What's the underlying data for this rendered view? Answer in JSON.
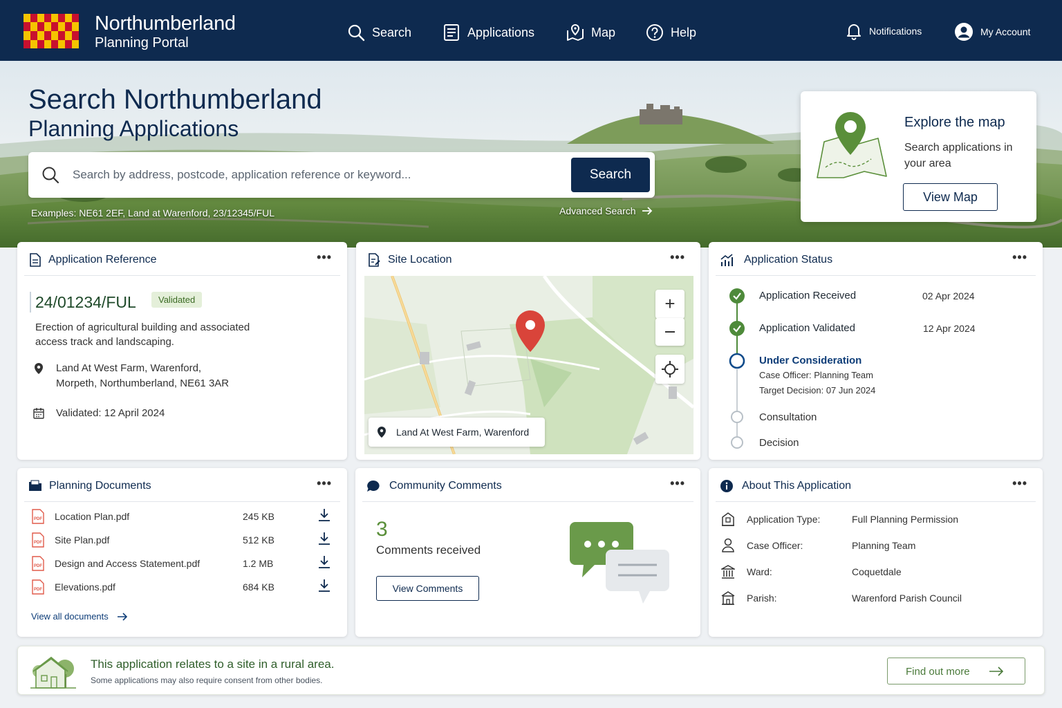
{
  "header": {
    "brand_title": "Northumberland",
    "brand_sub": "Planning Portal",
    "nav": [
      {
        "label": "Search",
        "icon": "search-icon"
      },
      {
        "label": "Applications",
        "icon": "document-icon"
      },
      {
        "label": "Map",
        "icon": "map-icon"
      },
      {
        "label": "Help",
        "icon": "help-icon"
      }
    ],
    "notifications_label": "Notifications",
    "account_label": "My Account"
  },
  "hero": {
    "title_line1": "Search Northumberland",
    "title_line2": "Planning Applications",
    "search_placeholder": "Search by address, postcode, application reference or keyword...",
    "search_button": "Search",
    "examples": "Examples:  NE61 2EF, Land at Warenford, 23/12345/FUL",
    "advanced_search": "Advanced Search"
  },
  "map_card": {
    "title": "Explore the map",
    "description": "Search applications in your area",
    "button": "View Map"
  },
  "reference_card": {
    "title": "Application Reference",
    "reference": "24/01234/FUL",
    "badge": "Validated",
    "description": "Erection of agricultural building and associated access track and landscaping.",
    "address_line1": "Land At West Farm, Warenford,",
    "address_line2": "Morpeth, Northumberland, NE61 3AR",
    "validated": "Validated: 12 April 2024"
  },
  "site_card": {
    "title": "Site Location",
    "location_label": "Land At West Farm, Warenford"
  },
  "status_card": {
    "title": "Application Status",
    "steps": [
      {
        "label": "Application Received",
        "date": "02 Apr 2024"
      },
      {
        "label": "Application Validated",
        "date": "12 Apr 2024"
      },
      {
        "label": "Under Consideration",
        "detail1": "Case Officer: Planning Team",
        "detail2": "Target Decision: 07 Jun 2024"
      },
      {
        "label": "Consultation"
      },
      {
        "label": "Decision"
      }
    ]
  },
  "documents_card": {
    "title": "Planning Documents",
    "files": [
      {
        "name": "Location Plan.pdf",
        "size": "245 KB"
      },
      {
        "name": "Site Plan.pdf",
        "size": "512 KB"
      },
      {
        "name": "Design and Access Statement.pdf",
        "size": "1.2 MB"
      },
      {
        "name": "Elevations.pdf",
        "size": "684 KB"
      }
    ],
    "view_all": "View all documents"
  },
  "comments_card": {
    "title": "Community Comments",
    "count": "3",
    "count_label": "Comments received",
    "button": "View Comments"
  },
  "about_card": {
    "title": "About This Application",
    "rows": [
      {
        "label": "Application Type:",
        "value": "Full Planning Permission"
      },
      {
        "label": "Case Officer:",
        "value": "Planning Team"
      },
      {
        "label": "Ward:",
        "value": "Coquetdale"
      },
      {
        "label": "Parish:",
        "value": "Warenford Parish Council"
      }
    ]
  },
  "banner": {
    "title": "This application relates to a site in a rural area.",
    "subtitle": "Some applications may also require consent from other bodies.",
    "button": "Find out more"
  },
  "colors": {
    "navy": "#0e2a4f",
    "green_check": "#4e8a3a",
    "badge_bg": "#e4efd9",
    "pin_red": "#d9443a",
    "map_pin_green": "#5a8f3a"
  }
}
